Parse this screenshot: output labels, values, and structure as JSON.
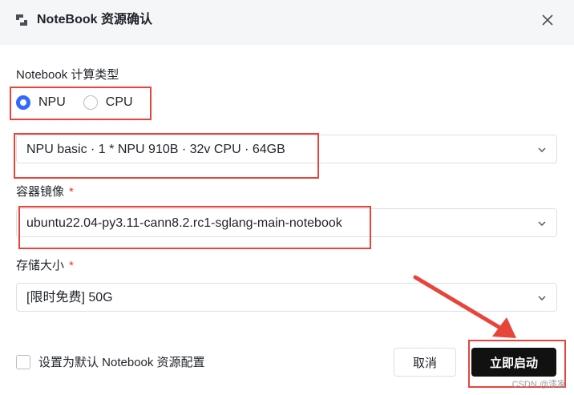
{
  "header": {
    "title": "NoteBook 资源确认"
  },
  "compute": {
    "label": "Notebook 计算类型",
    "options": [
      {
        "label": "NPU",
        "selected": true
      },
      {
        "label": "CPU",
        "selected": false
      }
    ]
  },
  "spec": {
    "value": "NPU basic  ·  1 * NPU 910B  ·  32v CPU  ·  64GB"
  },
  "image": {
    "label": "容器镜像",
    "required_mark": "*",
    "value": "ubuntu22.04-py3.11-cann8.2.rc1-sglang-main-notebook"
  },
  "storage": {
    "label": "存储大小",
    "required_mark": "*",
    "value": "[限时免费] 50G"
  },
  "footer": {
    "default_checkbox_label": "设置为默认 Notebook 资源配置",
    "cancel_label": "取消",
    "start_label": "立即启动"
  },
  "watermark": "CSDN @漆家",
  "colors": {
    "accent": "#2f6bff",
    "highlight": "#e8443a",
    "primary_button": "#111111"
  }
}
